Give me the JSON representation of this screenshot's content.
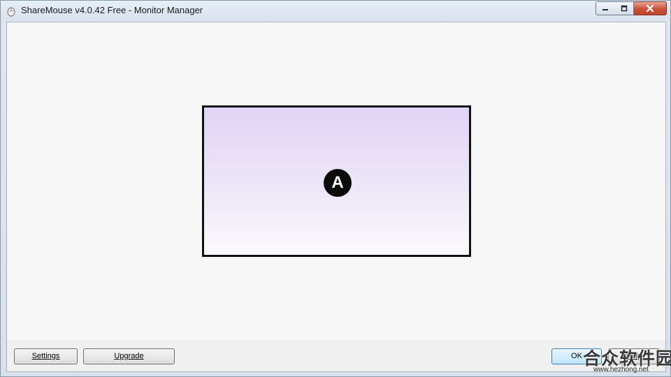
{
  "window": {
    "title": "ShareMouse v4.0.42 Free - Monitor Manager",
    "app_icon": "mouse-icon"
  },
  "monitor": {
    "label": "A"
  },
  "buttons": {
    "settings": "Settings",
    "upgrade": "Upgrade",
    "ok": "OK",
    "help": "Help"
  },
  "watermark": {
    "text": "合众软件园",
    "url": "www.hezhong.net"
  },
  "colors": {
    "monitor_gradient_top": "#e0d4f6",
    "monitor_border": "#111111",
    "close_button": "#c9503a"
  }
}
